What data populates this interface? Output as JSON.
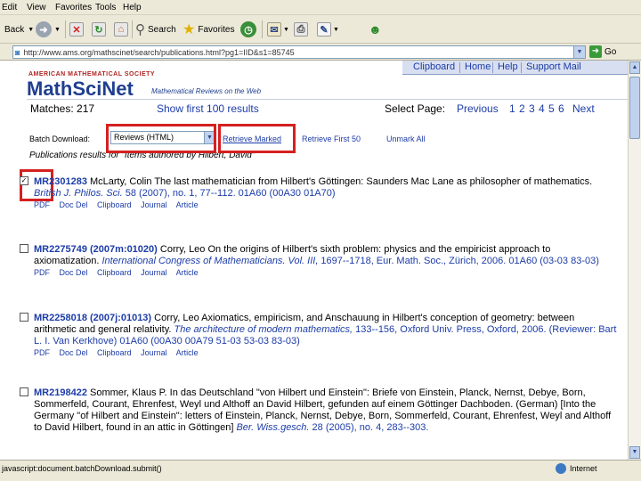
{
  "menubar": {
    "items": [
      "Edit",
      "View",
      "Favorites",
      "Tools",
      "Help"
    ]
  },
  "toolbar": {
    "back": "Back",
    "search": "Search",
    "favorites": "Favorites"
  },
  "address": {
    "url": "http://www.ams.org/mathscinet/search/publications.html?pg1=IID&s1=85745",
    "go": "Go"
  },
  "header": {
    "ams": "AMERICAN MATHEMATICAL SOCIETY",
    "logo": "MathSciNet",
    "tagline": "Mathematical Reviews on the Web",
    "nav": [
      "Clipboard",
      "Home",
      "Help",
      "Support Mail"
    ]
  },
  "results": {
    "matches": "Matches: 217",
    "show_first": "Show first 100 results",
    "select_page": "Select Page:",
    "previous": "Previous",
    "pages": [
      "1",
      "2",
      "3",
      "4",
      "5",
      "6"
    ],
    "next": "Next"
  },
  "batch": {
    "label": "Batch Download:",
    "selected": "Reviews (HTML)",
    "retrieve_marked": "Retrieve Marked",
    "retrieve_first": "Retrieve First 50",
    "unmark": "Unmark All"
  },
  "pubs_header": "Publications results for \"Items authored by Hilbert, David\"",
  "entries": [
    {
      "mr": "MR2301283",
      "text_a": " McLarty, Colin The last mathematician from Hilbert's Göttingen: Saunders Mac Lane as philosopher of mathematics.",
      "venue": "British J. Philos. Sci.",
      "text_b": " 58 (2007), no. 1, 77--112. 01A60 (00A30 01A70)",
      "links": [
        "PDF",
        "Doc Del",
        "Clipboard",
        "Journal",
        "Article"
      ]
    },
    {
      "mr": "MR2275749 (2007m:01020)",
      "text_a": " Corry, Leo On the origins of Hilbert's sixth problem: physics and the empiricist approach to axiomatization.",
      "venue": "International Congress of Mathematicians. Vol. III,",
      "text_b": " 1697--1718, Eur. Math. Soc., Zürich, 2006. 01A60 (03-03 83-03)",
      "links": [
        "PDF",
        "Doc Del",
        "Clipboard",
        "Journal",
        "Article"
      ]
    },
    {
      "mr": "MR2258018 (2007j:01013)",
      "text_a": " Corry, Leo Axiomatics, empiricism, and Anschauung in Hilbert's conception of geometry: between arithmetic and general relativity.",
      "venue": "The architecture of modern mathematics,",
      "text_b": " 133--156, Oxford Univ. Press, Oxford, 2006. (Reviewer: Bart L. I. Van Kerkhove) 01A60 (00A30 00A79 51-03 53-03 83-03)",
      "links": [
        "PDF",
        "Doc Del",
        "Clipboard",
        "Journal",
        "Article"
      ]
    },
    {
      "mr": "MR2198422",
      "text_a": " Sommer, Klaus P. In das Deutschland \"von Hilbert und Einstein\": Briefe von Einstein, Planck, Nernst, Debye, Born, Sommerfeld, Courant, Ehrenfest, Weyl und Althoff an David Hilbert, gefunden auf einem Göttinger Dachboden. (German) [Into the Germany \"of Hilbert and Einstein\": letters of Einstein, Planck, Nernst, Debye, Born, Sommerfeld, Courant, Ehrenfest, Weyl and Althoff to David Hilbert, found in an attic in Göttingen]",
      "venue": "Ber. Wiss.gesch.",
      "text_b": " 28 (2005), no. 4, 283--303.",
      "links": []
    }
  ],
  "status": {
    "text": "javascript:document.batchDownload.submit()",
    "zone": "Internet"
  }
}
